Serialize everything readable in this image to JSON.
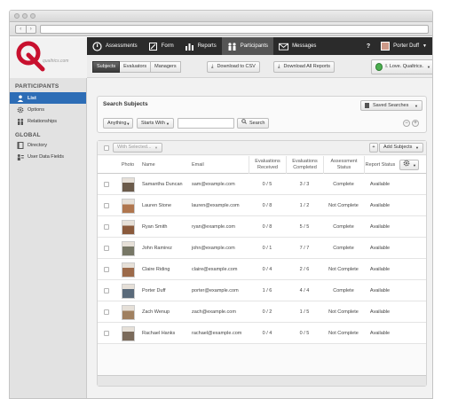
{
  "browser": {
    "back": "‹",
    "forward": "›"
  },
  "brand": {
    "logo_letter": "Q",
    "logo_text": "qualtrics.com"
  },
  "topnav": {
    "items": [
      {
        "label": "Assessments",
        "icon": "power-icon"
      },
      {
        "label": "Form",
        "icon": "edit-icon"
      },
      {
        "label": "Reports",
        "icon": "bar-chart-icon"
      },
      {
        "label": "Participants",
        "icon": "people-icon"
      },
      {
        "label": "Messages",
        "icon": "envelope-icon"
      }
    ],
    "help": "?",
    "user": "Porter Duff"
  },
  "subnav": {
    "tabs": [
      "Subjects",
      "Evaluators",
      "Managers"
    ],
    "download_csv": "Download to CSV",
    "download_reports": "Download All Reports",
    "account": "I. Love. Qualtrics."
  },
  "sidebar": {
    "sections": [
      {
        "heading": "PARTICIPANTS",
        "items": [
          "List",
          "Options",
          "Relationships"
        ]
      },
      {
        "heading": "GLOBAL",
        "items": [
          "Directory",
          "User Data Fields"
        ]
      }
    ]
  },
  "search": {
    "title": "Search Subjects",
    "saved_searches": "Saved Searches",
    "field_select": "Anything",
    "operator_select": "Starts With",
    "input_value": "",
    "button": "Search",
    "minus": "−",
    "plus": "+"
  },
  "table": {
    "with_selected": "With Selected...",
    "add_subjects": "Add Subjects",
    "add_icon": "+",
    "columns": [
      "Photo",
      "Name",
      "Email",
      "Evaluations Received",
      "Evaluations Completed",
      "Assessment Status",
      "Report Status"
    ],
    "rows": [
      {
        "name": "Samantha Duncan",
        "email": "sam@example.com",
        "received": "0 / 5",
        "completed": "3 / 3",
        "assessment": "Complete",
        "report": "Available",
        "photo_color": "#6b5b4b"
      },
      {
        "name": "Lauren Stone",
        "email": "lauren@example.com",
        "received": "0 / 8",
        "completed": "1 / 2",
        "assessment": "Not Complete",
        "report": "Available",
        "photo_color": "#b0764e"
      },
      {
        "name": "Ryan Smith",
        "email": "ryan@example.com",
        "received": "0 / 8",
        "completed": "5 / 5",
        "assessment": "Complete",
        "report": "Available",
        "photo_color": "#8a5a3c"
      },
      {
        "name": "John Ramirez",
        "email": "john@example.com",
        "received": "0 / 1",
        "completed": "7 / 7",
        "assessment": "Complete",
        "report": "Available",
        "photo_color": "#777766"
      },
      {
        "name": "Claire Riding",
        "email": "claire@example.com",
        "received": "0 / 4",
        "completed": "2 / 6",
        "assessment": "Not Complete",
        "report": "Available",
        "photo_color": "#9c6a4a"
      },
      {
        "name": "Porter Duff",
        "email": "porter@example.com",
        "received": "1 / 6",
        "completed": "4 / 4",
        "assessment": "Complete",
        "report": "Available",
        "photo_color": "#5a6a7a"
      },
      {
        "name": "Zach Wenup",
        "email": "zach@example.com",
        "received": "0 / 2",
        "completed": "1 / 5",
        "assessment": "Not Complete",
        "report": "Available",
        "photo_color": "#a08060"
      },
      {
        "name": "Rachael Hanks",
        "email": "rachael@example.com",
        "received": "0 / 4",
        "completed": "0 / 5",
        "assessment": "Not Complete",
        "report": "Available",
        "photo_color": "#7a6a5a"
      }
    ]
  },
  "colors": {
    "nav_bg": "#2b2b2b",
    "active_blue": "#2d6db6",
    "brand_red": "#c8102e"
  }
}
